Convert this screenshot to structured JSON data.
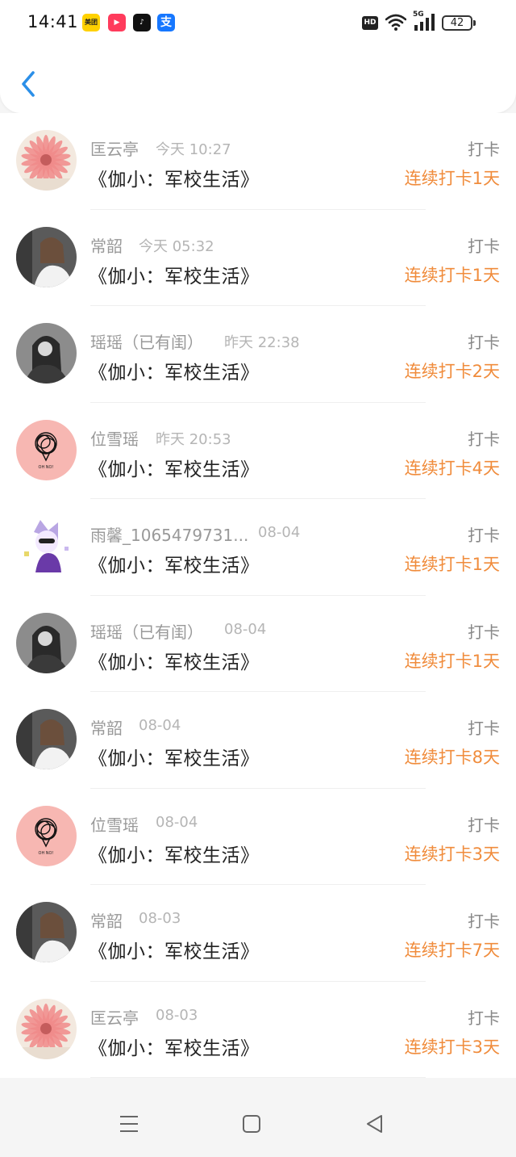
{
  "status_bar": {
    "time": "14:41",
    "apps": [
      {
        "name": "meituan-icon",
        "label": "美团"
      },
      {
        "name": "video-app-icon",
        "label": "▶"
      },
      {
        "name": "tiktok-icon",
        "label": "♪"
      },
      {
        "name": "alipay-icon",
        "label": "支"
      }
    ],
    "hd_label": "HD",
    "network_label": "5G",
    "battery_level": "42"
  },
  "header": {
    "back_icon": "chevron-left-icon",
    "accent_color": "#2b8fe8"
  },
  "theme": {
    "streak_color": "#f08c3c",
    "name_color": "#999999"
  },
  "records": [
    {
      "name": "匡云亭",
      "time": "今天 10:27",
      "book": "《伽小：军校生活》",
      "action": "打卡",
      "streak": "连续打卡1天",
      "avatar": "flower"
    },
    {
      "name": "常韶",
      "time": "今天 05:32",
      "book": "《伽小：军校生活》",
      "action": "打卡",
      "streak": "连续打卡1天",
      "avatar": "girl"
    },
    {
      "name": "瑶瑶（已有闺）",
      "time": "昨天 22:38",
      "book": "《伽小：军校生活》",
      "action": "打卡",
      "streak": "连续打卡2天",
      "avatar": "dark"
    },
    {
      "name": "位雪瑶",
      "time": "昨天 20:53",
      "book": "《伽小：军校生活》",
      "action": "打卡",
      "streak": "连续打卡4天",
      "avatar": "pink"
    },
    {
      "name": "雨馨_1065479731...",
      "time": "08-04",
      "book": "《伽小：军校生活》",
      "action": "打卡",
      "streak": "连续打卡1天",
      "avatar": "cartoon"
    },
    {
      "name": "瑶瑶（已有闺）",
      "time": "08-04",
      "book": "《伽小：军校生活》",
      "action": "打卡",
      "streak": "连续打卡1天",
      "avatar": "dark"
    },
    {
      "name": "常韶",
      "time": "08-04",
      "book": "《伽小：军校生活》",
      "action": "打卡",
      "streak": "连续打卡8天",
      "avatar": "girl"
    },
    {
      "name": "位雪瑶",
      "time": "08-04",
      "book": "《伽小：军校生活》",
      "action": "打卡",
      "streak": "连续打卡3天",
      "avatar": "pink"
    },
    {
      "name": "常韶",
      "time": "08-03",
      "book": "《伽小：军校生活》",
      "action": "打卡",
      "streak": "连续打卡7天",
      "avatar": "girl"
    },
    {
      "name": "匡云亭",
      "time": "08-03",
      "book": "《伽小：军校生活》",
      "action": "打卡",
      "streak": "连续打卡3天",
      "avatar": "flower"
    }
  ],
  "nav_bar": {
    "menu_icon": "menu-icon",
    "home_icon": "home-square-icon",
    "back_icon": "back-triangle-icon"
  }
}
